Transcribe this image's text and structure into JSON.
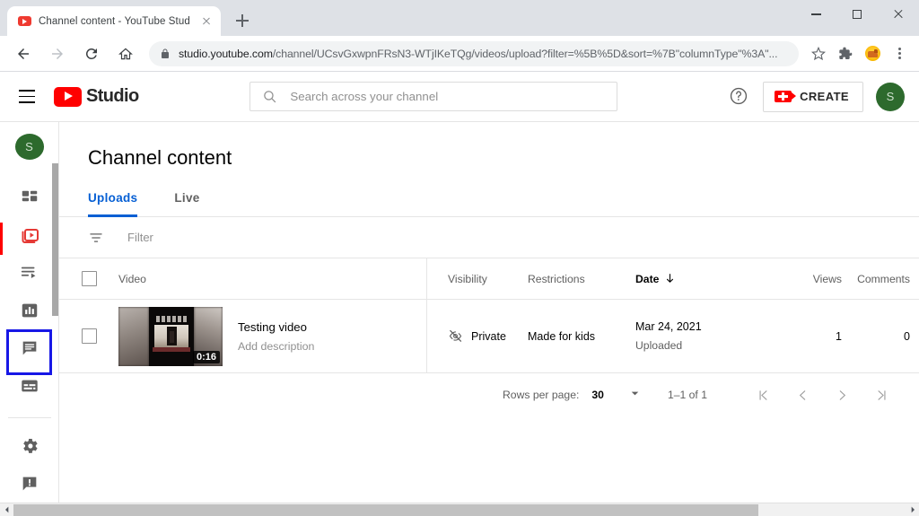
{
  "browser": {
    "tab": {
      "title": "Channel content - YouTube Stud",
      "favicon": "youtube-icon"
    },
    "new_tab_label": "+",
    "url": "studio.youtube.com",
    "url_path": "/channel/UCsvGxwpnFRsN3-WTjIKeTQg/videos/upload?filter=%5B%5D&sort=%7B\"columnType\"%3A\"...",
    "window_controls": [
      "minimize",
      "maximize",
      "close"
    ],
    "toolbar_icons": [
      "back-icon",
      "forward-icon",
      "reload-icon",
      "home-icon",
      "lock-icon",
      "bookmark-star-icon",
      "extensions-puzzle-icon",
      "extension-dog-icon",
      "chrome-menu-icon"
    ]
  },
  "header": {
    "menu_icon": "hamburger-icon",
    "brand": "Studio",
    "search_placeholder": "Search across your channel",
    "help_icon": "help-circle-icon",
    "create_label": "CREATE",
    "avatar_initial": "S"
  },
  "sidebar": {
    "avatar_initial": "S",
    "items": [
      {
        "name": "dashboard",
        "icon": "dashboard-grid-icon",
        "active": false
      },
      {
        "name": "content",
        "icon": "video-stack-icon",
        "active": true
      },
      {
        "name": "playlists",
        "icon": "playlist-icon",
        "active": false
      },
      {
        "name": "analytics",
        "icon": "analytics-bar-icon",
        "active": false
      },
      {
        "name": "comments",
        "icon": "comment-icon",
        "active": false
      },
      {
        "name": "subtitles",
        "icon": "subtitles-icon",
        "active": false
      },
      {
        "name": "settings",
        "icon": "gear-icon",
        "active": false
      },
      {
        "name": "feedback",
        "icon": "feedback-icon",
        "active": false
      }
    ]
  },
  "main": {
    "title": "Channel content",
    "tabs": [
      {
        "label": "Uploads",
        "active": true
      },
      {
        "label": "Live",
        "active": false
      }
    ],
    "filter": {
      "icon": "filter-icon",
      "placeholder": "Filter"
    },
    "table": {
      "columns": [
        "Video",
        "Visibility",
        "Restrictions",
        "Date",
        "Views",
        "Comments"
      ],
      "sort_column": "Date",
      "sort_direction": "descending",
      "rows": [
        {
          "title": "Testing video",
          "description": "Add description",
          "duration": "0:16",
          "visibility": "Private",
          "visibility_icon": "eye-off-icon",
          "restrictions": "Made for kids",
          "date": "Mar 24, 2021",
          "date_sub": "Uploaded",
          "views": "1",
          "comments": "0"
        }
      ]
    },
    "pagination": {
      "rows_per_page_label": "Rows per page:",
      "rows_per_page_value": "30",
      "range": "1–1 of 1",
      "buttons": [
        "first-page",
        "previous-page",
        "next-page",
        "last-page"
      ]
    }
  },
  "colors": {
    "brand_red": "#ff0000",
    "accent_blue": "#065fd4",
    "selection_blue": "#1717e6",
    "avatar_green": "#2d6a2d"
  }
}
